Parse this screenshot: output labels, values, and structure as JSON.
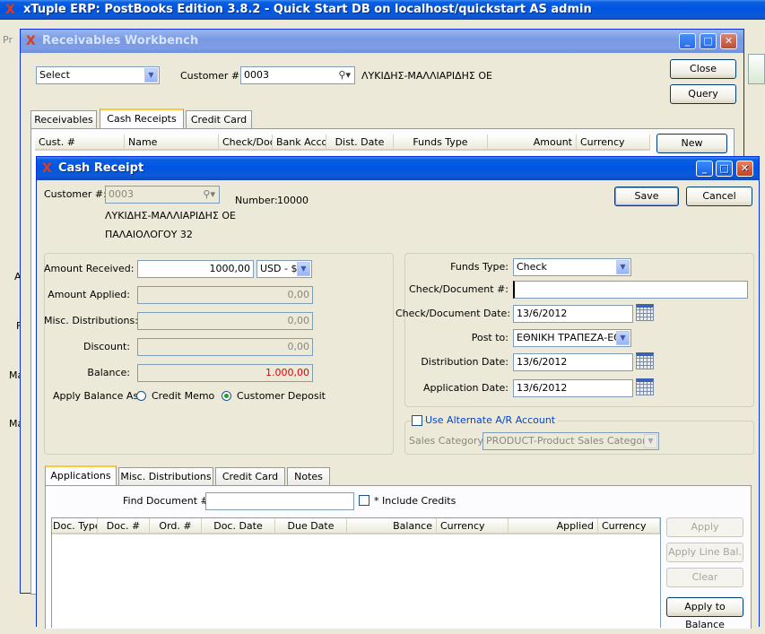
{
  "main_window": {
    "title": "xTuple ERP: PostBooks Edition 3.8.2 - Quick Start DB on localhost/quickstart AS admin"
  },
  "bg_labels": {
    "pr": "Pr",
    "a": "A",
    "f": "F",
    "ma1": "Ma",
    "ma2": "Ma"
  },
  "workbench": {
    "title": "Receivables Workbench",
    "select_value": "Select",
    "customer_label": "Customer #:",
    "customer_value": "0003",
    "customer_name": "ΛΥΚΙΔΗΣ-ΜΑΛΛΙΑΡΙΔΗΣ ΟΕ",
    "close_label": "Close",
    "query_label": "Query",
    "new_label": "New",
    "tabs": [
      "Receivables",
      "Cash Receipts",
      "Credit Card"
    ],
    "columns": [
      "Cust. #",
      "Name",
      "Check/Doc",
      "Bank Accou",
      "Dist. Date",
      "Funds Type",
      "Amount",
      "Currency"
    ]
  },
  "cash_receipt": {
    "title": "Cash Receipt",
    "customer_label": "Customer #:",
    "customer_value": "0003",
    "number_label": "Number:",
    "number_value": "10000",
    "customer_name": "ΛΥΚΙΔΗΣ-ΜΑΛΛΙΑΡΙΔΗΣ ΟΕ",
    "customer_address": "ΠΑΛΑΙΟΛΟΓΟΥ 32",
    "save_label": "Save",
    "cancel_label": "Cancel",
    "amounts": {
      "received_label": "Amount Received:",
      "received_value": "1000,00",
      "currency": "USD - $",
      "applied_label": "Amount Applied:",
      "applied_value": "0,00",
      "misc_label": "Misc. Distributions:",
      "misc_value": "0,00",
      "discount_label": "Discount:",
      "discount_value": "0,00",
      "balance_label": "Balance:",
      "balance_value": "1.000,00",
      "apply_as_label": "Apply Balance As:",
      "credit_memo_label": "Credit Memo",
      "customer_deposit_label": "Customer Deposit"
    },
    "funds": {
      "funds_type_label": "Funds Type:",
      "funds_type_value": "Check",
      "check_doc_label": "Check/Document #:",
      "check_doc_value": "",
      "check_date_label": "Check/Document Date:",
      "check_date_value": "13/6/2012",
      "post_to_label": "Post to:",
      "post_to_value": "ΕΘΝΙΚΗ ΤΡΑΠΕΖΑ-ΕΘΝ",
      "dist_date_label": "Distribution Date:",
      "dist_date_value": "13/6/2012",
      "app_date_label": "Application Date:",
      "app_date_value": "13/6/2012",
      "alt_ar_label": "Use Alternate A/R Account",
      "sales_cat_label": "Sales Category:",
      "sales_cat_value": "PRODUCT-Product Sales Category"
    },
    "tabs": [
      "Applications",
      "Misc. Distributions",
      "Credit Card",
      "Notes"
    ],
    "find_doc_label": "Find Document #:",
    "find_doc_value": "",
    "include_credits_label": "* Include Credits",
    "columns": [
      "Doc. Type",
      "Doc. #",
      "Ord. #",
      "Doc. Date",
      "Due Date",
      "Balance",
      "Currency",
      "Applied",
      "Currency"
    ],
    "apply_label": "Apply",
    "apply_line_label": "Apply Line Bal.",
    "clear_label": "Clear",
    "apply_to_balance_label": "Apply to Balance"
  },
  "colors": {
    "accent_title": "#0054e3",
    "balance_red": "#e00000",
    "tab_highlight": "#ffc83c"
  }
}
